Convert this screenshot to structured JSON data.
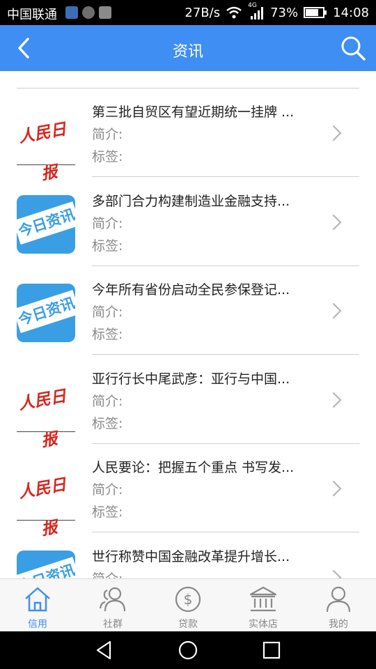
{
  "status_bar": {
    "carrier": "中国联通",
    "network_speed": "27B/s",
    "network_type": "4G",
    "battery": "73%",
    "time": "14:08"
  },
  "header": {
    "title": "资讯",
    "back_icon": "chevron-left-icon",
    "search_icon": "search-icon",
    "color": "#3f8ef3"
  },
  "news": {
    "intro_label": "简介:",
    "tags_label": "标签:",
    "items": [
      {
        "title": "第三批自贸区有望近期统一挂牌 ...",
        "logo": "人民日报"
      },
      {
        "title": "多部门合力构建制造业金融支持...",
        "logo": "今日资讯"
      },
      {
        "title": "今年所有省份启动全民参保登记...",
        "logo": "今日资讯"
      },
      {
        "title": "亚行行长中尾武彦：亚行与中国...",
        "logo": "人民日报"
      },
      {
        "title": "人民要论：把握五个重点 书写发...",
        "logo": "人民日报"
      },
      {
        "title": "世行称赞中国金融改革提升增长...",
        "logo": "今日资讯"
      }
    ]
  },
  "tabs": [
    {
      "label": "信用",
      "icon": "home-icon",
      "active": true
    },
    {
      "label": "社群",
      "icon": "community-icon",
      "active": false
    },
    {
      "label": "贷款",
      "icon": "dollar-coin-icon",
      "active": false
    },
    {
      "label": "实体店",
      "icon": "bank-building-icon",
      "active": false
    },
    {
      "label": "我的",
      "icon": "profile-icon",
      "active": false
    }
  ]
}
